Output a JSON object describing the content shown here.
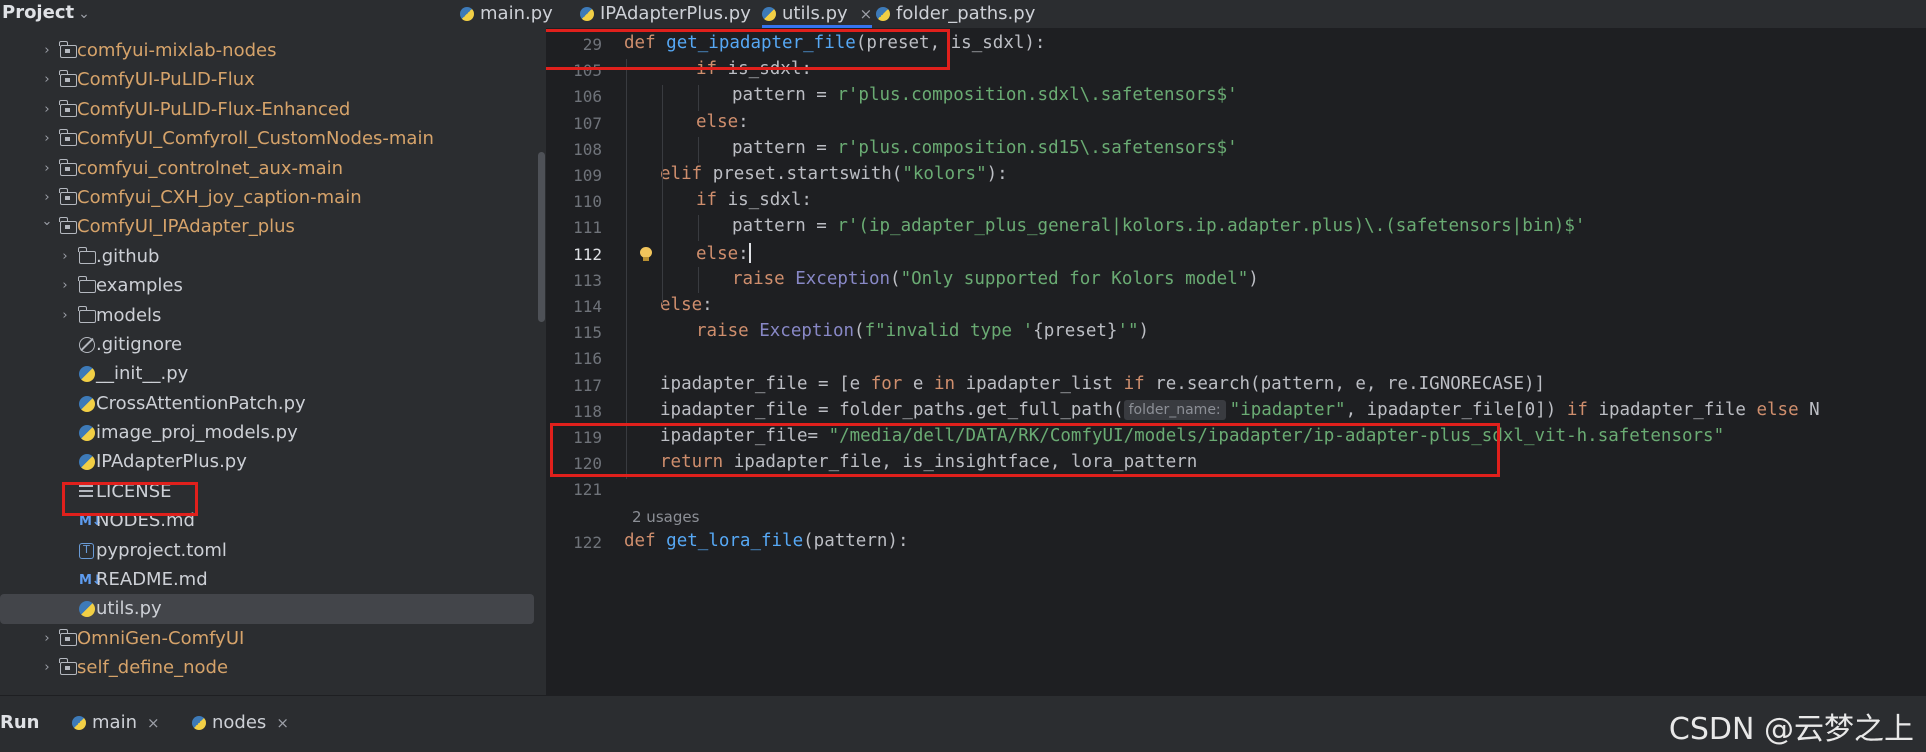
{
  "project": {
    "title": "Project"
  },
  "tree": [
    {
      "label": "comfyui-mixlab-nodes",
      "type": "module",
      "depth": 0,
      "arrow": "right",
      "color": "orange"
    },
    {
      "label": "ComfyUI-PuLID-Flux",
      "type": "module",
      "depth": 0,
      "arrow": "right",
      "color": "orange"
    },
    {
      "label": "ComfyUI-PuLID-Flux-Enhanced",
      "type": "module",
      "depth": 0,
      "arrow": "right",
      "color": "orange"
    },
    {
      "label": "ComfyUI_Comfyroll_CustomNodes-main",
      "type": "module",
      "depth": 0,
      "arrow": "right",
      "color": "orange"
    },
    {
      "label": "comfyui_controlnet_aux-main",
      "type": "module",
      "depth": 0,
      "arrow": "right",
      "color": "orange"
    },
    {
      "label": "Comfyui_CXH_joy_caption-main",
      "type": "module",
      "depth": 0,
      "arrow": "right",
      "color": "orange"
    },
    {
      "label": "ComfyUI_IPAdapter_plus",
      "type": "module",
      "depth": 0,
      "arrow": "down",
      "color": "orange"
    },
    {
      "label": ".github",
      "type": "folder",
      "depth": 1,
      "arrow": "right",
      "color": "plain"
    },
    {
      "label": "examples",
      "type": "folder",
      "depth": 1,
      "arrow": "right",
      "color": "plain"
    },
    {
      "label": "models",
      "type": "folder",
      "depth": 1,
      "arrow": "right",
      "color": "plain"
    },
    {
      "label": ".gitignore",
      "type": "git",
      "depth": 1,
      "arrow": "",
      "color": "plain"
    },
    {
      "label": "__init__.py",
      "type": "py",
      "depth": 1,
      "arrow": "",
      "color": "plain"
    },
    {
      "label": "CrossAttentionPatch.py",
      "type": "py",
      "depth": 1,
      "arrow": "",
      "color": "plain"
    },
    {
      "label": "image_proj_models.py",
      "type": "py",
      "depth": 1,
      "arrow": "",
      "color": "plain"
    },
    {
      "label": "IPAdapterPlus.py",
      "type": "py",
      "depth": 1,
      "arrow": "",
      "color": "plain"
    },
    {
      "label": "LICENSE",
      "type": "license",
      "depth": 1,
      "arrow": "",
      "color": "plain"
    },
    {
      "label": "NODES.md",
      "type": "md",
      "depth": 1,
      "arrow": "",
      "color": "plain"
    },
    {
      "label": "pyproject.toml",
      "type": "toml",
      "depth": 1,
      "arrow": "",
      "color": "plain"
    },
    {
      "label": "README.md",
      "type": "md",
      "depth": 1,
      "arrow": "",
      "color": "plain"
    },
    {
      "label": "utils.py",
      "type": "py",
      "depth": 1,
      "arrow": "",
      "color": "plain",
      "selected": true
    },
    {
      "label": "OmniGen-ComfyUI",
      "type": "module",
      "depth": 0,
      "arrow": "right",
      "color": "orange"
    },
    {
      "label": "self_define_node",
      "type": "module",
      "depth": 0,
      "arrow": "right",
      "color": "orange"
    }
  ],
  "tabs": [
    {
      "label": "main.py",
      "active": false
    },
    {
      "label": "IPAdapterPlus.py",
      "active": false
    },
    {
      "label": "utils.py",
      "active": true,
      "close": "×"
    },
    {
      "label": "folder_paths.py",
      "active": false
    }
  ],
  "editor": {
    "usages_hint": "2 usages",
    "inlay_hint": "folder_name:",
    "lines": [
      {
        "num": "29",
        "indent": 0,
        "tokens": [
          [
            "kw",
            "def "
          ],
          [
            "fn",
            "get_ipadapter_file"
          ],
          [
            "t",
            "(preset, is_sdxl):"
          ]
        ]
      },
      {
        "num": "105",
        "indent": 2,
        "tokens": [
          [
            "kw",
            "if "
          ],
          [
            "t",
            "is_sdxl:"
          ]
        ]
      },
      {
        "num": "106",
        "indent": 3,
        "tokens": [
          [
            "t",
            "pattern = "
          ],
          [
            "str",
            "r'plus.composition.sdxl\\.safetensors$'"
          ]
        ]
      },
      {
        "num": "107",
        "indent": 2,
        "tokens": [
          [
            "kw",
            "else"
          ],
          [
            "t",
            ":"
          ]
        ]
      },
      {
        "num": "108",
        "indent": 3,
        "tokens": [
          [
            "t",
            "pattern = "
          ],
          [
            "str",
            "r'plus.composition.sd15\\.safetensors$'"
          ]
        ]
      },
      {
        "num": "109",
        "indent": 1,
        "tokens": [
          [
            "kw",
            "elif "
          ],
          [
            "t",
            "preset.startswith("
          ],
          [
            "str",
            "\"kolors\""
          ],
          [
            "t",
            "):"
          ]
        ]
      },
      {
        "num": "110",
        "indent": 2,
        "tokens": [
          [
            "kw",
            "if "
          ],
          [
            "t",
            "is_sdxl:"
          ]
        ]
      },
      {
        "num": "111",
        "indent": 3,
        "tokens": [
          [
            "t",
            "pattern = "
          ],
          [
            "str",
            "r'(ip_adapter_plus_general|kolors.ip.adapter.plus)\\.(safetensors|bin)$'"
          ]
        ]
      },
      {
        "num": "112",
        "indent": 2,
        "tokens": [
          [
            "kw",
            "else"
          ],
          [
            "t",
            ":"
          ]
        ],
        "current": true
      },
      {
        "num": "113",
        "indent": 3,
        "tokens": [
          [
            "kw",
            "raise "
          ],
          [
            "bi",
            "Exception"
          ],
          [
            "t",
            "("
          ],
          [
            "str",
            "\"Only supported for Kolors model\""
          ],
          [
            "t",
            ")"
          ]
        ]
      },
      {
        "num": "114",
        "indent": 1,
        "tokens": [
          [
            "kw",
            "else"
          ],
          [
            "t",
            ":"
          ]
        ]
      },
      {
        "num": "115",
        "indent": 2,
        "tokens": [
          [
            "kw",
            "raise "
          ],
          [
            "bi",
            "Exception"
          ],
          [
            "t",
            "("
          ],
          [
            "str",
            "f\"invalid type '"
          ],
          [
            "t",
            "{preset}"
          ],
          [
            "str",
            "'\""
          ],
          [
            "t",
            ")"
          ]
        ]
      },
      {
        "num": "116",
        "indent": 0,
        "tokens": []
      },
      {
        "num": "117",
        "indent": 1,
        "tokens": [
          [
            "t",
            "ipadapter_file = [e "
          ],
          [
            "kw",
            "for "
          ],
          [
            "t",
            "e "
          ],
          [
            "kw",
            "in "
          ],
          [
            "t",
            "ipadapter_list "
          ],
          [
            "kw",
            "if "
          ],
          [
            "t",
            "re.search(pattern, e, re.IGNORECASE)]"
          ]
        ]
      },
      {
        "num": "118",
        "indent": 1,
        "tokens": [
          [
            "t",
            "ipadapter_file = folder_paths.get_full_path("
          ],
          [
            "inlay",
            ""
          ],
          [
            "str",
            "\"ipadapter\""
          ],
          [
            "t",
            ", ipadapter_file[0]) "
          ],
          [
            "kw",
            "if "
          ],
          [
            "t",
            "ipadapter_file "
          ],
          [
            "kw",
            "else "
          ],
          [
            "t",
            "N"
          ]
        ]
      },
      {
        "num": "119",
        "indent": 1,
        "tokens": [
          [
            "t",
            "ipadapter_file= "
          ],
          [
            "str",
            "\"/media/dell/DATA/RK/ComfyUI/models/ipadapter/ip-adapter-plus_sdxl_vit-h.safetensors\""
          ]
        ]
      },
      {
        "num": "120",
        "indent": 1,
        "tokens": [
          [
            "kw",
            "return "
          ],
          [
            "t",
            "ipadapter_file, is_insightface, lora_pattern"
          ]
        ]
      },
      {
        "num": "121",
        "indent": 0,
        "tokens": []
      },
      {
        "num": "",
        "indent": 0,
        "tokens": [],
        "usages": true
      },
      {
        "num": "122",
        "indent": 0,
        "tokens": [
          [
            "kw",
            "def "
          ],
          [
            "fn",
            "get_lora_file"
          ],
          [
            "t",
            "(pattern):"
          ]
        ]
      }
    ]
  },
  "bottombar": {
    "run_label": "Run",
    "tabs": [
      {
        "label": "main",
        "close": "×"
      },
      {
        "label": "nodes",
        "close": "×"
      }
    ],
    "watermark": "CSDN @云梦之上"
  },
  "colors": {
    "highlight_box": "#e0201c",
    "accent": "#3574f0"
  }
}
